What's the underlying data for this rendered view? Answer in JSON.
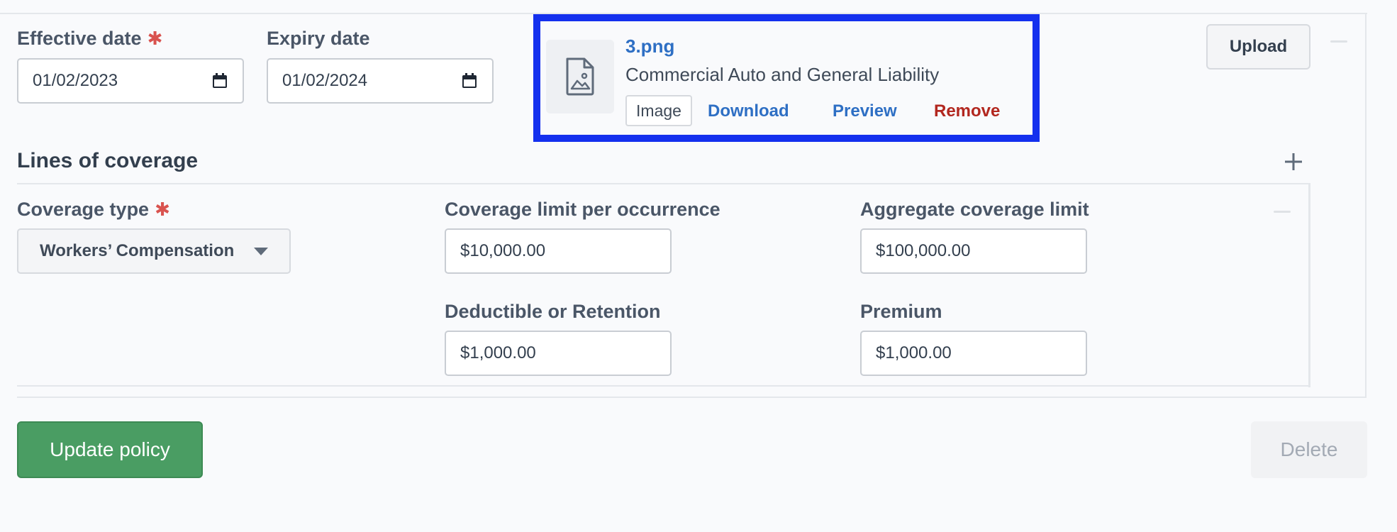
{
  "policy": {
    "effective_date": {
      "label": "Effective date",
      "value": "01/02/2023",
      "required": true
    },
    "expiry_date": {
      "label": "Expiry date",
      "value": "01/02/2024"
    }
  },
  "attachment": {
    "file_name": "3.png",
    "description": "Commercial Auto and General Liability",
    "type_badge": "Image",
    "actions": {
      "download": "Download",
      "preview": "Preview",
      "remove": "Remove"
    }
  },
  "upload_button": "Upload",
  "coverage": {
    "section_title": "Lines of coverage",
    "coverage_type": {
      "label": "Coverage type",
      "value": "Workers’ Compensation",
      "required": true
    },
    "limit_per_occurrence": {
      "label": "Coverage limit per occurrence",
      "value": "$10,000.00"
    },
    "aggregate_limit": {
      "label": "Aggregate coverage limit",
      "value": "$100,000.00"
    },
    "deductible": {
      "label": "Deductible or Retention",
      "value": "$1,000.00"
    },
    "premium": {
      "label": "Premium",
      "value": "$1,000.00"
    }
  },
  "buttons": {
    "update": "Update policy",
    "delete": "Delete"
  },
  "colors": {
    "highlight_border": "#1430ee",
    "link": "#2e6fc4",
    "remove": "#b2271f",
    "primary_green": "#4a9d63",
    "required": "#d9534f"
  },
  "icons": {
    "file_thumbnail": "image-file-icon",
    "date_picker": "calendar-icon",
    "add_line": "plus-icon",
    "remove_line": "minus-icon",
    "dropdown": "caret-down-icon"
  }
}
